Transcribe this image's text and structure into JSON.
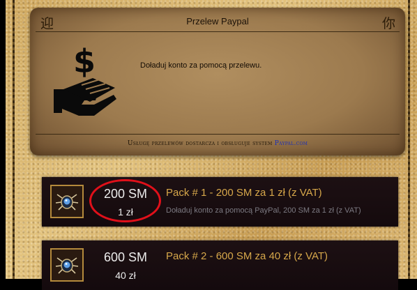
{
  "panel": {
    "title": "Przelew Paypal",
    "corner_left": "迎",
    "corner_right": "你",
    "description": "Doładuj konto za pomocą przelewu.",
    "footer_prefix": "Usługę przelewów dostarcza i obsługuje system ",
    "footer_link": "Paypal.com",
    "icon": "money-hand-icon"
  },
  "packs": [
    {
      "amount": "200 SM",
      "price": "1 zł",
      "title": "Pack # 1 - 200 SM za 1 zł (z VAT)",
      "description": "Doładuj konto za pomocą PayPal, 200 SM za 1 zł (z VAT)",
      "icon": "scarab-icon",
      "highlighted": true
    },
    {
      "amount": "600 SM",
      "price": "40 zł",
      "title": "Pack # 2 - 600 SM za 40 zł (z VAT)",
      "description": "",
      "icon": "scarab-icon",
      "highlighted": false
    }
  ],
  "colors": {
    "pack_title": "#d6a74a",
    "highlight": "#e0101a",
    "link": "#1a2fb8"
  }
}
